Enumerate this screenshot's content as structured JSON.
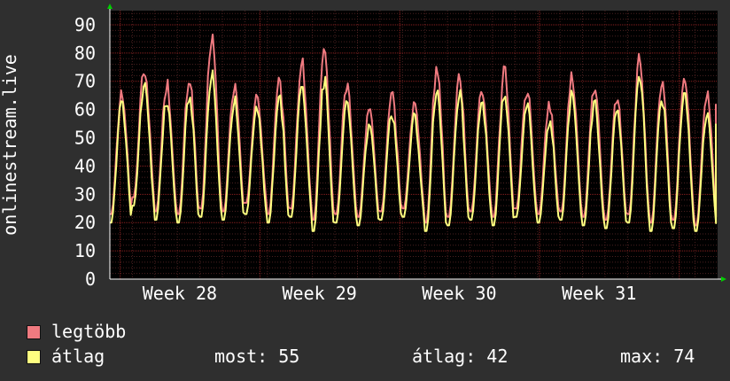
{
  "chart_data": {
    "type": "line",
    "ylabel": "onlinestream.live",
    "ylim": [
      0,
      95
    ],
    "yticks": [
      0,
      10,
      20,
      30,
      40,
      50,
      60,
      70,
      80,
      90
    ],
    "xticks": [
      "Week 28",
      "Week 29",
      "Week 30",
      "Week 31"
    ],
    "grid": true,
    "colors": {
      "background": "#000000",
      "grid_major": "#8b2020",
      "grid_minor": "#4a2020",
      "axis": "#ffffff",
      "arrow": "#00cc00"
    },
    "series": [
      {
        "name": "legtöbb",
        "color": "#f07a80",
        "peaks": [
          66,
          75,
          69,
          71,
          86,
          68,
          64,
          69,
          76,
          79,
          69,
          60,
          65,
          62,
          75,
          72,
          68,
          73,
          67,
          61,
          71,
          68,
          64,
          77,
          69,
          72,
          65
        ],
        "lows": [
          23,
          29,
          24,
          23,
          25,
          24,
          27,
          23,
          25,
          21,
          23,
          22,
          24,
          25,
          20,
          22,
          24,
          22,
          25,
          23,
          24,
          22,
          21,
          23,
          20,
          21,
          19
        ],
        "last": 62
      },
      {
        "name": "átlag",
        "color": "#ffff80",
        "peaks": [
          62,
          69,
          64,
          65,
          72,
          63,
          60,
          64,
          68,
          70,
          62,
          55,
          58,
          57,
          67,
          66,
          62,
          65,
          61,
          56,
          65,
          62,
          59,
          73,
          64,
          66,
          60
        ],
        "lows": [
          20,
          26,
          21,
          20,
          22,
          21,
          23,
          20,
          22,
          17,
          20,
          19,
          21,
          22,
          17,
          19,
          21,
          19,
          22,
          20,
          21,
          19,
          18,
          20,
          17,
          18,
          17
        ],
        "last": 55
      }
    ]
  },
  "legend": {
    "max_label": "legtöbb",
    "avg_label": "átlag",
    "max_color": "#f07a80",
    "avg_color": "#ffff80",
    "now_text": "most: 55",
    "avg_text": "átlag: 42",
    "max_text": "max: 74"
  }
}
